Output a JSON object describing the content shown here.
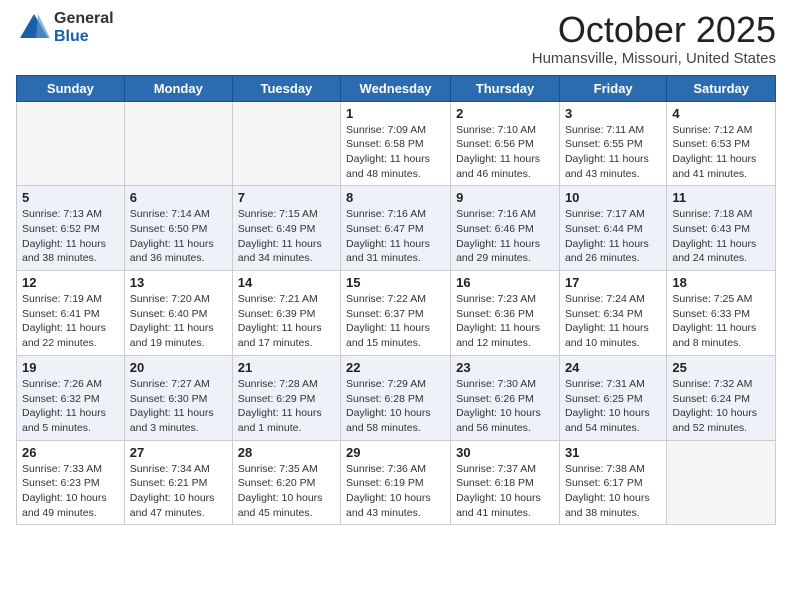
{
  "logo": {
    "general": "General",
    "blue": "Blue"
  },
  "header": {
    "month": "October 2025",
    "location": "Humansville, Missouri, United States"
  },
  "weekdays": [
    "Sunday",
    "Monday",
    "Tuesday",
    "Wednesday",
    "Thursday",
    "Friday",
    "Saturday"
  ],
  "weeks": [
    [
      {
        "day": "",
        "info": ""
      },
      {
        "day": "",
        "info": ""
      },
      {
        "day": "",
        "info": ""
      },
      {
        "day": "1",
        "info": "Sunrise: 7:09 AM\nSunset: 6:58 PM\nDaylight: 11 hours and 48 minutes."
      },
      {
        "day": "2",
        "info": "Sunrise: 7:10 AM\nSunset: 6:56 PM\nDaylight: 11 hours and 46 minutes."
      },
      {
        "day": "3",
        "info": "Sunrise: 7:11 AM\nSunset: 6:55 PM\nDaylight: 11 hours and 43 minutes."
      },
      {
        "day": "4",
        "info": "Sunrise: 7:12 AM\nSunset: 6:53 PM\nDaylight: 11 hours and 41 minutes."
      }
    ],
    [
      {
        "day": "5",
        "info": "Sunrise: 7:13 AM\nSunset: 6:52 PM\nDaylight: 11 hours and 38 minutes."
      },
      {
        "day": "6",
        "info": "Sunrise: 7:14 AM\nSunset: 6:50 PM\nDaylight: 11 hours and 36 minutes."
      },
      {
        "day": "7",
        "info": "Sunrise: 7:15 AM\nSunset: 6:49 PM\nDaylight: 11 hours and 34 minutes."
      },
      {
        "day": "8",
        "info": "Sunrise: 7:16 AM\nSunset: 6:47 PM\nDaylight: 11 hours and 31 minutes."
      },
      {
        "day": "9",
        "info": "Sunrise: 7:16 AM\nSunset: 6:46 PM\nDaylight: 11 hours and 29 minutes."
      },
      {
        "day": "10",
        "info": "Sunrise: 7:17 AM\nSunset: 6:44 PM\nDaylight: 11 hours and 26 minutes."
      },
      {
        "day": "11",
        "info": "Sunrise: 7:18 AM\nSunset: 6:43 PM\nDaylight: 11 hours and 24 minutes."
      }
    ],
    [
      {
        "day": "12",
        "info": "Sunrise: 7:19 AM\nSunset: 6:41 PM\nDaylight: 11 hours and 22 minutes."
      },
      {
        "day": "13",
        "info": "Sunrise: 7:20 AM\nSunset: 6:40 PM\nDaylight: 11 hours and 19 minutes."
      },
      {
        "day": "14",
        "info": "Sunrise: 7:21 AM\nSunset: 6:39 PM\nDaylight: 11 hours and 17 minutes."
      },
      {
        "day": "15",
        "info": "Sunrise: 7:22 AM\nSunset: 6:37 PM\nDaylight: 11 hours and 15 minutes."
      },
      {
        "day": "16",
        "info": "Sunrise: 7:23 AM\nSunset: 6:36 PM\nDaylight: 11 hours and 12 minutes."
      },
      {
        "day": "17",
        "info": "Sunrise: 7:24 AM\nSunset: 6:34 PM\nDaylight: 11 hours and 10 minutes."
      },
      {
        "day": "18",
        "info": "Sunrise: 7:25 AM\nSunset: 6:33 PM\nDaylight: 11 hours and 8 minutes."
      }
    ],
    [
      {
        "day": "19",
        "info": "Sunrise: 7:26 AM\nSunset: 6:32 PM\nDaylight: 11 hours and 5 minutes."
      },
      {
        "day": "20",
        "info": "Sunrise: 7:27 AM\nSunset: 6:30 PM\nDaylight: 11 hours and 3 minutes."
      },
      {
        "day": "21",
        "info": "Sunrise: 7:28 AM\nSunset: 6:29 PM\nDaylight: 11 hours and 1 minute."
      },
      {
        "day": "22",
        "info": "Sunrise: 7:29 AM\nSunset: 6:28 PM\nDaylight: 10 hours and 58 minutes."
      },
      {
        "day": "23",
        "info": "Sunrise: 7:30 AM\nSunset: 6:26 PM\nDaylight: 10 hours and 56 minutes."
      },
      {
        "day": "24",
        "info": "Sunrise: 7:31 AM\nSunset: 6:25 PM\nDaylight: 10 hours and 54 minutes."
      },
      {
        "day": "25",
        "info": "Sunrise: 7:32 AM\nSunset: 6:24 PM\nDaylight: 10 hours and 52 minutes."
      }
    ],
    [
      {
        "day": "26",
        "info": "Sunrise: 7:33 AM\nSunset: 6:23 PM\nDaylight: 10 hours and 49 minutes."
      },
      {
        "day": "27",
        "info": "Sunrise: 7:34 AM\nSunset: 6:21 PM\nDaylight: 10 hours and 47 minutes."
      },
      {
        "day": "28",
        "info": "Sunrise: 7:35 AM\nSunset: 6:20 PM\nDaylight: 10 hours and 45 minutes."
      },
      {
        "day": "29",
        "info": "Sunrise: 7:36 AM\nSunset: 6:19 PM\nDaylight: 10 hours and 43 minutes."
      },
      {
        "day": "30",
        "info": "Sunrise: 7:37 AM\nSunset: 6:18 PM\nDaylight: 10 hours and 41 minutes."
      },
      {
        "day": "31",
        "info": "Sunrise: 7:38 AM\nSunset: 6:17 PM\nDaylight: 10 hours and 38 minutes."
      },
      {
        "day": "",
        "info": ""
      }
    ]
  ]
}
